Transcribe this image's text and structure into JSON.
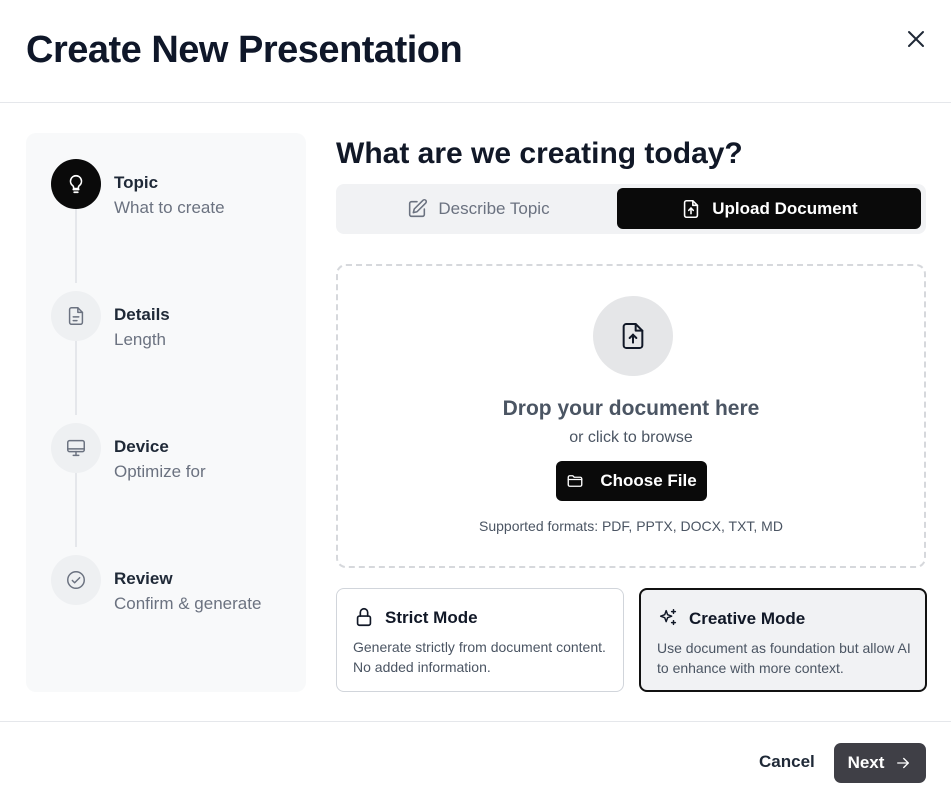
{
  "dialog": {
    "title": "Create New Presentation",
    "close_icon": "close-icon"
  },
  "steps": [
    {
      "title": "Topic",
      "subtitle": "What to create",
      "icon": "lightbulb-icon",
      "active": true
    },
    {
      "title": "Details",
      "subtitle": "Length",
      "icon": "document-icon",
      "active": false
    },
    {
      "title": "Device",
      "subtitle": "Optimize for",
      "icon": "monitor-icon",
      "active": false
    },
    {
      "title": "Review",
      "subtitle": "Confirm & generate",
      "icon": "check-circle-icon",
      "active": false
    }
  ],
  "main": {
    "heading": "What are we creating today?",
    "tabs": [
      {
        "label": "Describe Topic",
        "icon": "pencil-icon",
        "selected": false
      },
      {
        "label": "Upload Document",
        "icon": "file-upload-icon",
        "selected": true
      }
    ]
  },
  "dropzone": {
    "title": "Drop your document here",
    "subtitle": "or click to browse",
    "button_label": "Choose File",
    "formats": "Supported formats: PDF, PPTX, DOCX, TXT, MD"
  },
  "modes": [
    {
      "title": "Strict Mode",
      "description": "Generate strictly from document content. No added information.",
      "icon": "lock-icon",
      "selected": false
    },
    {
      "title": "Creative Mode",
      "description": "Use document as foundation but allow AI to enhance with more context.",
      "icon": "sparkles-icon",
      "selected": true
    }
  ],
  "footer": {
    "cancel_label": "Cancel",
    "next_label": "Next"
  },
  "colors": {
    "primary": "#0a0a0a",
    "next_button": "#3f3f46",
    "sidebar_bg": "#f8f9fa"
  }
}
